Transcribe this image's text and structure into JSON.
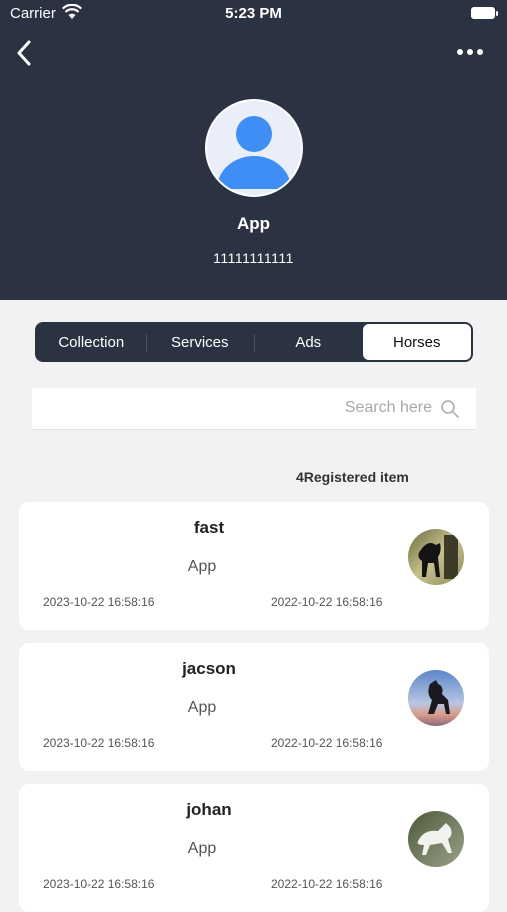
{
  "status_bar": {
    "carrier": "Carrier",
    "time": "5:23 PM"
  },
  "profile": {
    "name": "App",
    "phone": "11111111111"
  },
  "tabs": [
    {
      "label": "Collection",
      "active": false
    },
    {
      "label": "Services",
      "active": false
    },
    {
      "label": "Ads",
      "active": false
    },
    {
      "label": "Horses",
      "active": true
    }
  ],
  "search": {
    "placeholder": "Search here",
    "value": ""
  },
  "results": {
    "count_label": "4Registered item"
  },
  "items": [
    {
      "title": "fast",
      "subtitle": "App",
      "date_left": "2023-10-22 16:58:16",
      "date_right": "2022-10-22 16:58:16",
      "thumbnail": "black-horse-photo"
    },
    {
      "title": "jacson",
      "subtitle": "App",
      "date_left": "2023-10-22 16:58:16",
      "date_right": "2022-10-22 16:58:16",
      "thumbnail": "rearing-horse-sunset-photo"
    },
    {
      "title": "johan",
      "subtitle": "App",
      "date_left": "2023-10-22 16:58:16",
      "date_right": "2022-10-22 16:58:16",
      "thumbnail": "white-horse-photo"
    }
  ],
  "colors": {
    "header_bg": "#2b3241",
    "page_bg": "#f2f2f2",
    "avatar_blue": "#3e8ef5"
  }
}
